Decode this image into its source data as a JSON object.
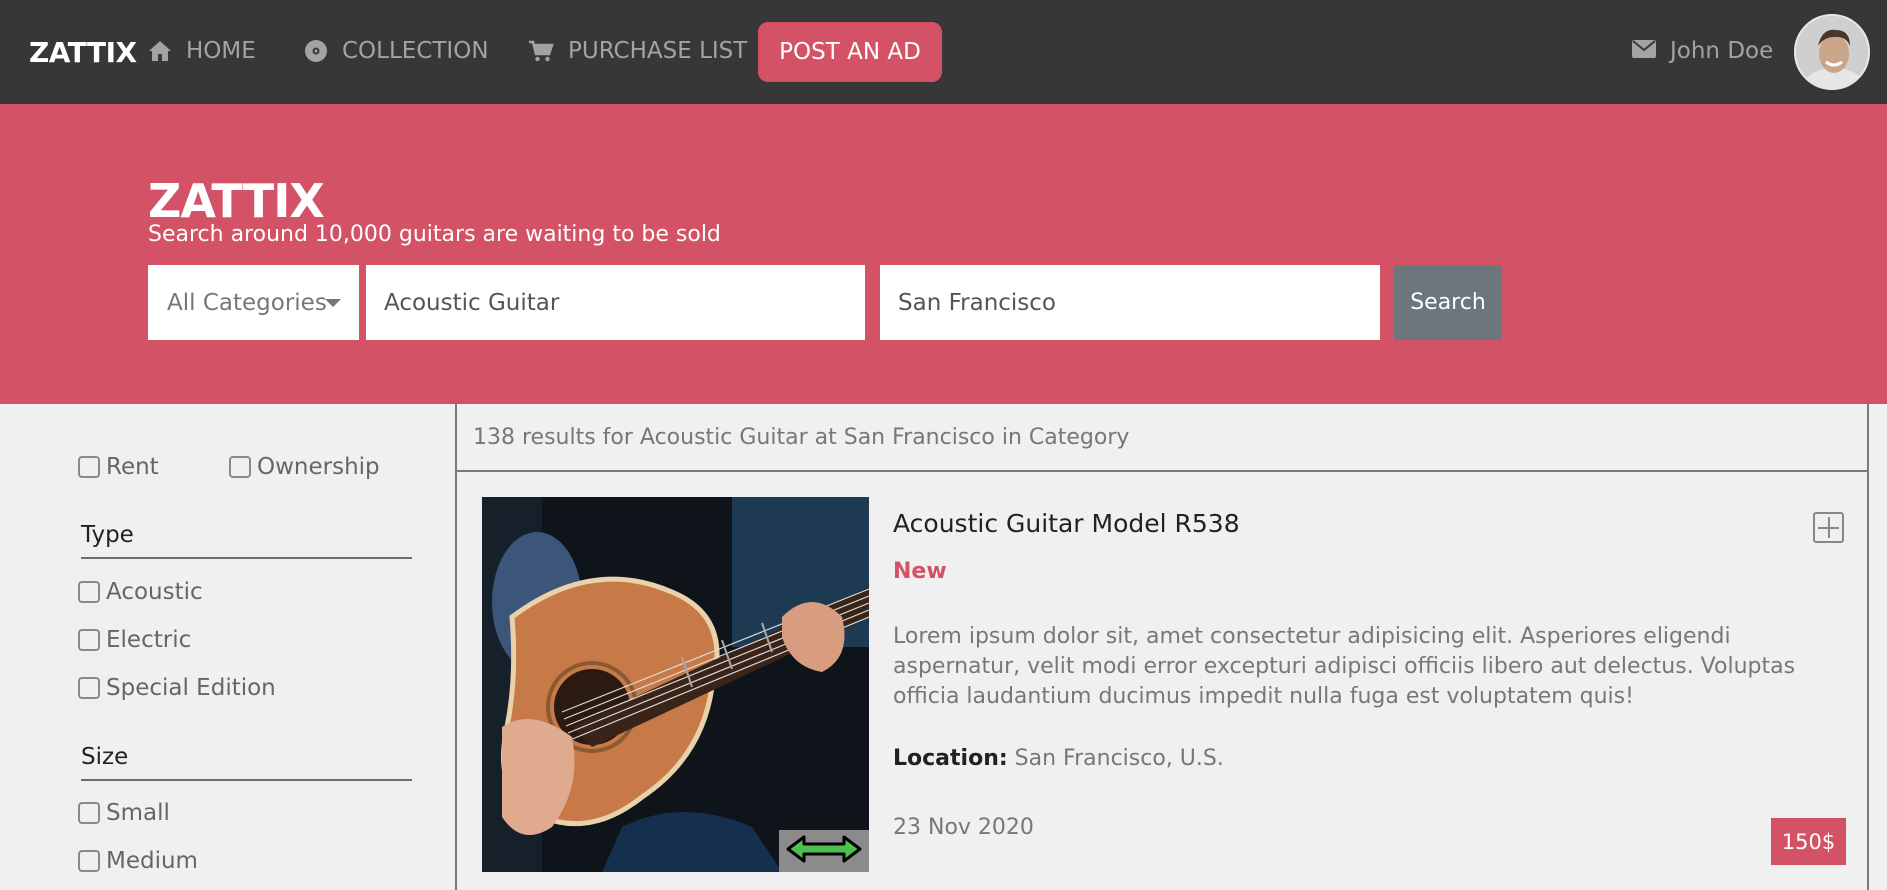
{
  "nav": {
    "brand": "ZATTIX",
    "items": [
      {
        "label": "HOME",
        "icon": "home-icon"
      },
      {
        "label": "COLLECTION",
        "icon": "disc-icon"
      },
      {
        "label": "PURCHASE LIST",
        "icon": "cart-icon"
      }
    ],
    "post_ad": "POST AN AD",
    "user_name": "John Doe",
    "user_icon": "mail-icon"
  },
  "hero": {
    "title": "ZATTIX",
    "subtitle": "Search around 10,000 guitars are waiting to be sold",
    "category": "All Categories",
    "keyword": "Acoustic Guitar",
    "location": "San Francisco",
    "search_label": "Search"
  },
  "filters": {
    "ownership": [
      {
        "label": "Rent",
        "checked": false
      },
      {
        "label": "Ownership",
        "checked": false
      }
    ],
    "type": {
      "title": "Type",
      "options": [
        {
          "label": "Acoustic",
          "checked": false
        },
        {
          "label": "Electric",
          "checked": false
        },
        {
          "label": "Special Edition",
          "checked": false
        }
      ]
    },
    "size": {
      "title": "Size",
      "options": [
        {
          "label": "Small",
          "checked": false
        },
        {
          "label": "Medium",
          "checked": false
        }
      ]
    }
  },
  "results": {
    "summary": "138 results for Acoustic Guitar at San Francisco in Category",
    "items": [
      {
        "title": "Acoustic Guitar Model R538",
        "condition": "New",
        "description": "Lorem ipsum dolor sit, amet consectetur adipisicing elit. Asperiores eligendi aspernatur, velit modi error excepturi adipisci officiis libero aut delectus. Voluptas officia laudantium ducimus impedit nulla fuga est voluptatem quis!",
        "location_label": "Location:",
        "location": "San Francisco, U.S.",
        "date": "23 Nov 2020",
        "price": "150$"
      }
    ]
  },
  "colors": {
    "accent": "#d35266",
    "navbar": "#373737",
    "search_button": "#6d757d",
    "handle_arrow": "#4fbf4f"
  }
}
